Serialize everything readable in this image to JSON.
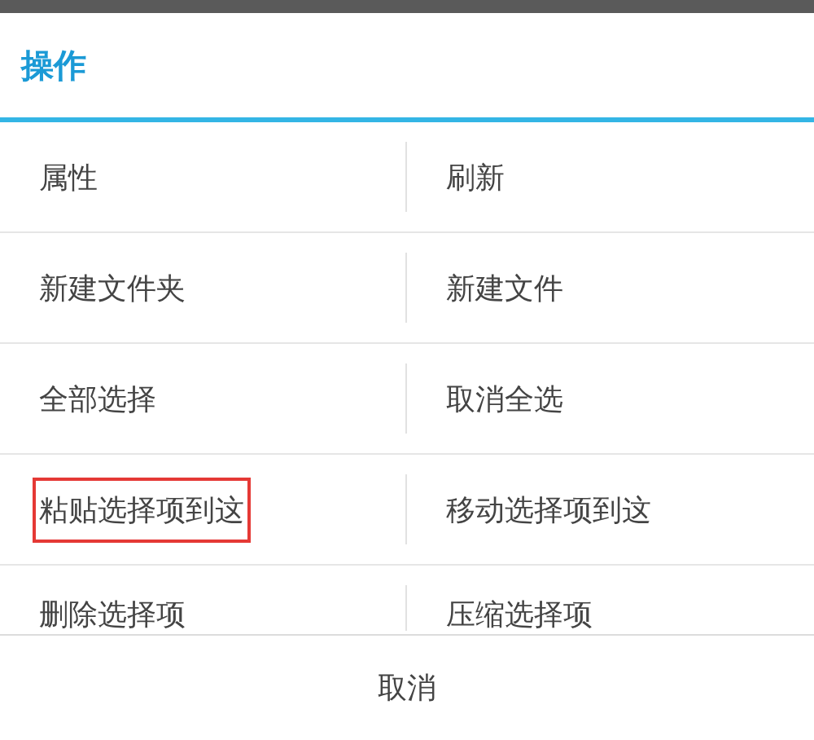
{
  "dialog": {
    "title": "操作"
  },
  "options": [
    {
      "label": "属性",
      "highlighted": false
    },
    {
      "label": "刷新",
      "highlighted": false
    },
    {
      "label": "新建文件夹",
      "highlighted": false
    },
    {
      "label": "新建文件",
      "highlighted": false
    },
    {
      "label": "全部选择",
      "highlighted": false
    },
    {
      "label": "取消全选",
      "highlighted": false
    },
    {
      "label": "粘贴选择项到这",
      "highlighted": true
    },
    {
      "label": "移动选择项到这",
      "highlighted": false
    },
    {
      "label": "删除选择项",
      "highlighted": false
    },
    {
      "label": "压缩选择项",
      "highlighted": false
    }
  ],
  "buttons": [
    "取消"
  ]
}
